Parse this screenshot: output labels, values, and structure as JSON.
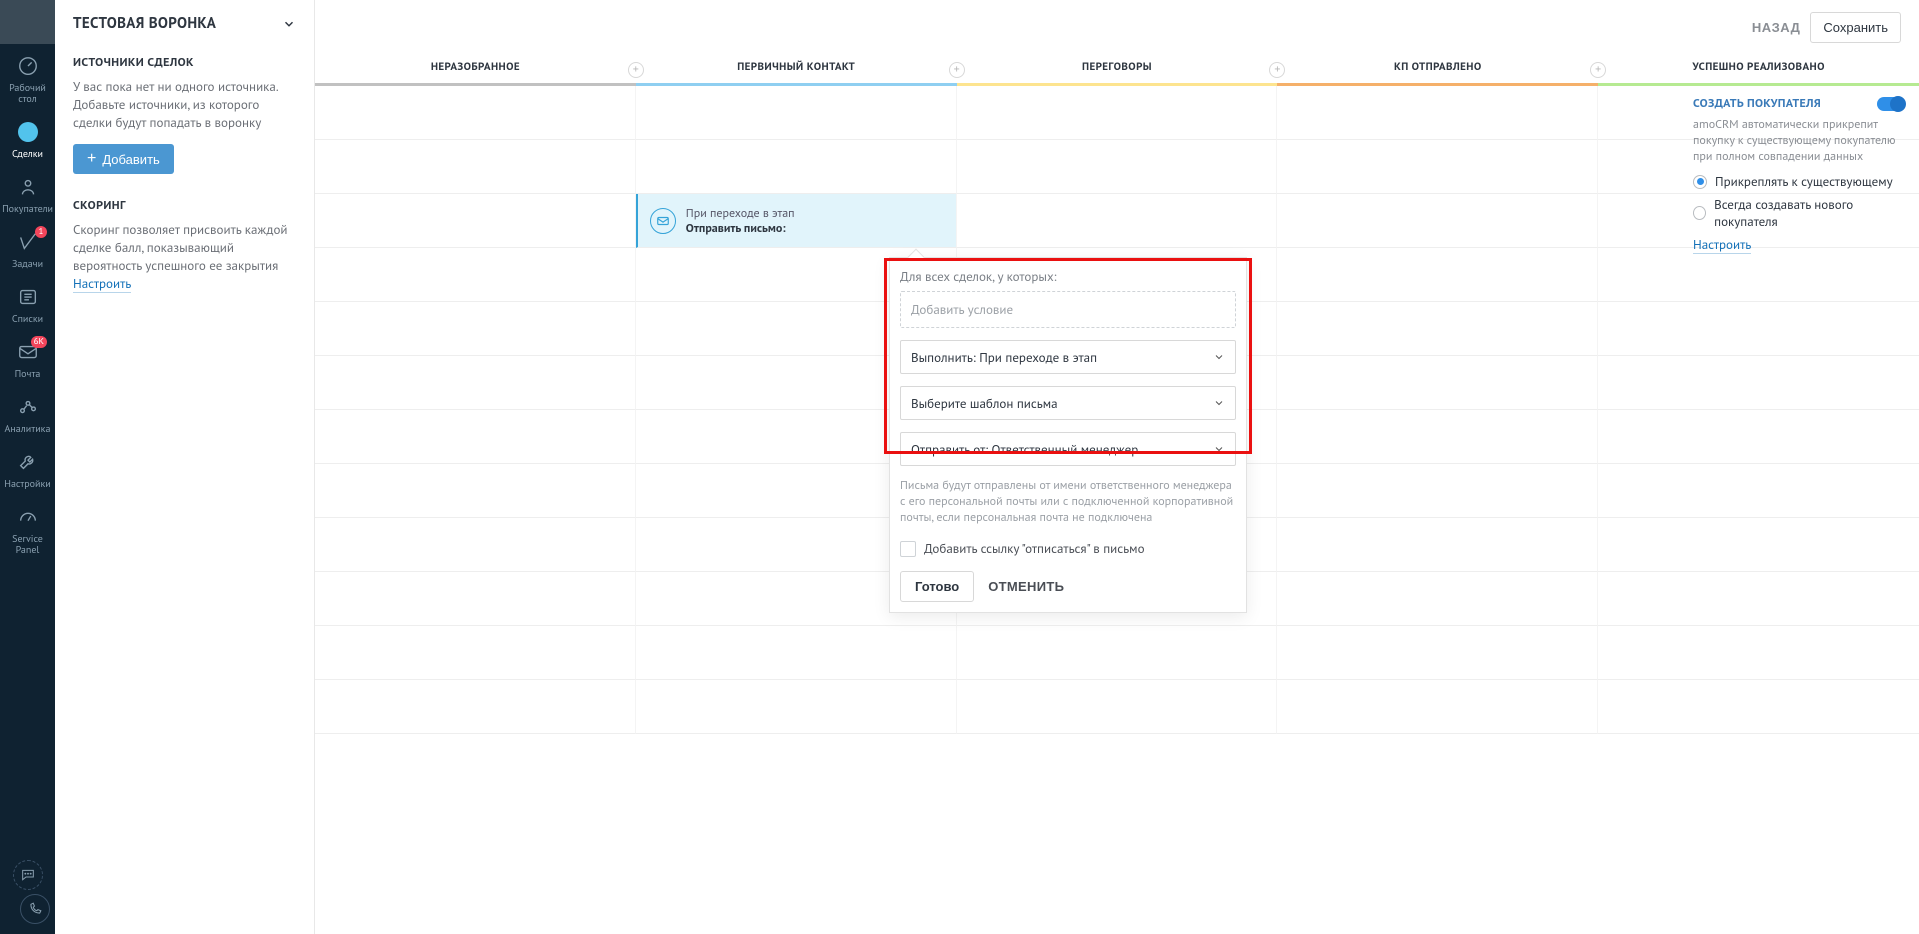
{
  "nav": {
    "items": [
      {
        "label": "Рабочий\n стол"
      },
      {
        "label": "Сделки"
      },
      {
        "label": "Покупатели"
      },
      {
        "label": "Задачи",
        "badge": "1"
      },
      {
        "label": "Списки"
      },
      {
        "label": "Почта",
        "badge": "6K"
      },
      {
        "label": "Аналитика"
      },
      {
        "label": "Настройки"
      },
      {
        "label": "Service\nPanel"
      }
    ]
  },
  "side": {
    "pipeline": "ТЕСТОВАЯ ВОРОНКА",
    "sources": {
      "title": "ИСТОЧНИКИ СДЕЛОК",
      "desc": "У вас пока нет ни одного источника. Добавьте источники, из которого сделки будут попадать в воронку",
      "add": "Добавить"
    },
    "scoring": {
      "title": "СКОРИНГ",
      "desc": "Скоринг позволяет присвоить каждой сделке балл, показывающий вероятность успешного ее закрытия",
      "link": "Настроить"
    }
  },
  "topbar": {
    "back": "НАЗАД",
    "save": "Сохранить"
  },
  "stages": [
    {
      "title": "НЕРАЗОБРАННОЕ",
      "color": "#c1c1c1"
    },
    {
      "title": "ПЕРВИЧНЫЙ КОНТАКТ",
      "color": "#8fcff1"
    },
    {
      "title": "ПЕРЕГОВОРЫ",
      "color": "#fde48f"
    },
    {
      "title": "КП ОТПРАВЛЕНО",
      "color": "#f5b06a"
    },
    {
      "title": "УСПЕШНО РЕАЛИЗОВАНО",
      "color": "#b6ea92"
    }
  ],
  "trigger": {
    "line1": "При переходе в этап",
    "line2": "Отправить письмо:"
  },
  "popup": {
    "for_all": "Для всех сделок, у которых:",
    "add_cond": "Добавить условие",
    "execute": "Выполнить: При переходе в этап",
    "template": "Выберите шаблон письма",
    "send_from": "Отправить от: Ответственный менеджер",
    "note": "Письма будут отправлены от имени ответственного менеджера с его персональной почты или с подключенной корпоративной почты, если персональная почта не подключена",
    "unsub": "Добавить ссылку \"отписаться\" в письмо",
    "done": "Готово",
    "cancel": "ОТМЕНИТЬ"
  },
  "right": {
    "title": "СОЗДАТЬ ПОКУПАТЕЛЯ",
    "desc": "amoCRM автоматически прикрепит покупку к существующему покупателю при полном совпадении данных",
    "radio1": "Прикреплять к существующему",
    "radio2": "Всегда создавать нового покупателя",
    "link": "Настроить"
  }
}
